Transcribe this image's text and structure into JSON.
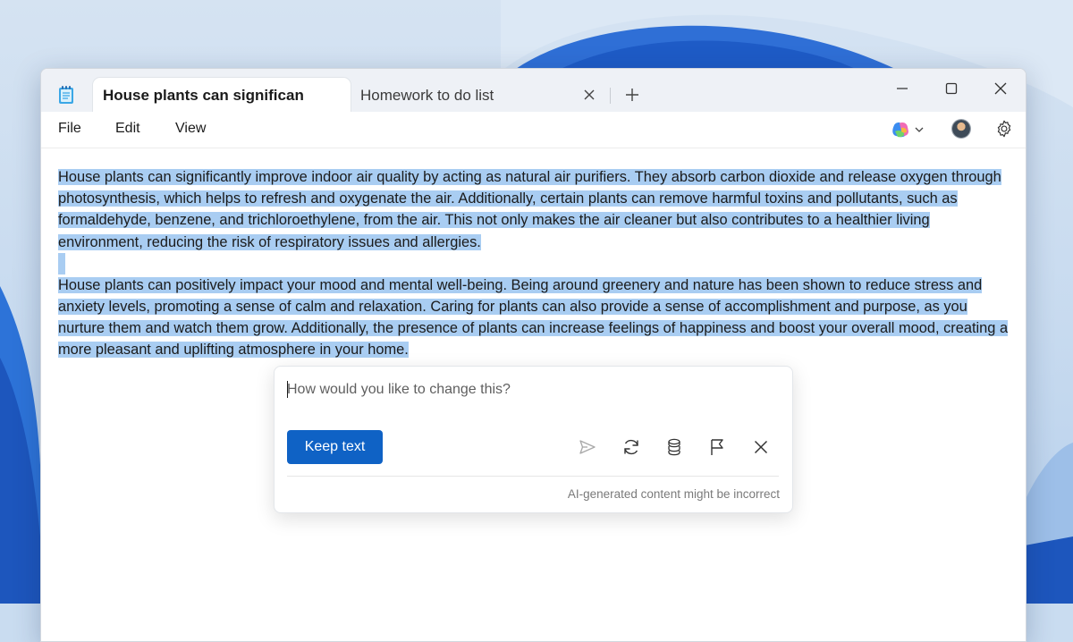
{
  "tabs": [
    {
      "label": "House plants can significan",
      "active": true
    },
    {
      "label": "Homework to do list",
      "active": false
    }
  ],
  "menu": [
    "File",
    "Edit",
    "View"
  ],
  "document": {
    "paragraphs": [
      "House plants can significantly improve indoor air quality by acting as natural air purifiers. They absorb carbon dioxide and release oxygen through photosynthesis, which helps to refresh and oxygenate the air. Additionally, certain plants can remove harmful toxins and pollutants, such as formaldehyde, benzene, and trichloroethylene, from the air. This not only makes the air cleaner but also contributes to a healthier living environment, reducing the risk of respiratory issues and allergies.",
      "House plants can positively impact your mood and mental well-being. Being around greenery and nature has been shown to reduce stress and anxiety levels, promoting a sense of calm and relaxation. Caring for plants can also provide a sense of accomplishment and purpose, as you nurture them and watch them grow. Additionally, the presence of plants can increase feelings of happiness and boost your overall mood, creating a more pleasant and uplifting atmosphere in your home."
    ]
  },
  "rewrite_prompt": {
    "placeholder": "How would you like to change this?",
    "keep_label": "Keep text",
    "disclaimer": "AI-generated content might be incorrect"
  },
  "icons": {
    "app": "notepad-icon",
    "copilot": "copilot-icon",
    "settings": "gear-icon",
    "send": "send-icon",
    "regenerate": "refresh-icon",
    "stack": "stack-icon",
    "flag": "flag-icon",
    "close": "close-icon"
  },
  "colors": {
    "selection": "#a9cdf2",
    "accent": "#0f62c5"
  }
}
